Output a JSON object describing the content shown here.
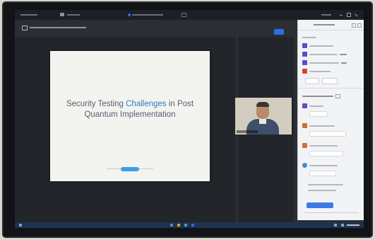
{
  "slide": {
    "title_lines": [
      {
        "before": "Security Testing",
        "highlight": "Challenges",
        "after": "in Post"
      },
      {
        "before": "Quantum Implementation",
        "highlight": "",
        "after": ""
      }
    ]
  },
  "colors": {
    "slide_text": "#5a5f6b",
    "slide_highlight": "#2b7fc4",
    "accent_blue": "#3d7ae6",
    "taskbar": "#20324f"
  },
  "icons": {
    "record": "record-icon",
    "close": "close-icon"
  }
}
